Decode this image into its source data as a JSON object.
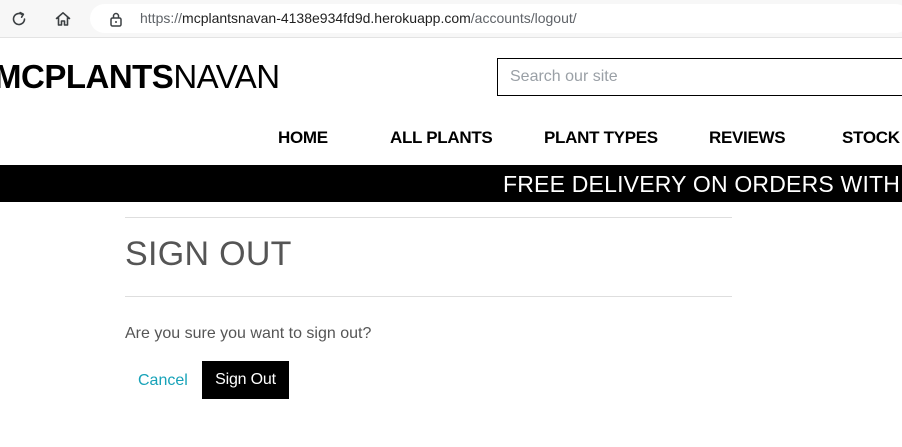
{
  "browser": {
    "url_scheme": "https://",
    "url_host": "mcplantsnavan-4138e934fd9d.herokuapp.com",
    "url_path": "/accounts/logout/",
    "icons": [
      "reload-icon",
      "home-icon",
      "lock-icon"
    ]
  },
  "header": {
    "logo_bold": "MCPLANTS",
    "logo_light": "NAVAN",
    "search_placeholder": "Search our site"
  },
  "nav": {
    "items": [
      {
        "label": "HOME"
      },
      {
        "label": "ALL PLANTS"
      },
      {
        "label": "PLANT TYPES"
      },
      {
        "label": "REVIEWS"
      },
      {
        "label": "STOCK"
      }
    ]
  },
  "promo": {
    "text": "FREE DELIVERY ON ORDERS WITHIN"
  },
  "signout": {
    "title": "SIGN OUT",
    "question": "Are you sure you want to sign out?",
    "cancel_label": "Cancel",
    "submit_label": "Sign Out"
  },
  "colors": {
    "link": "#17a2b8",
    "button_bg": "#000000",
    "promo_bg": "#000000"
  }
}
